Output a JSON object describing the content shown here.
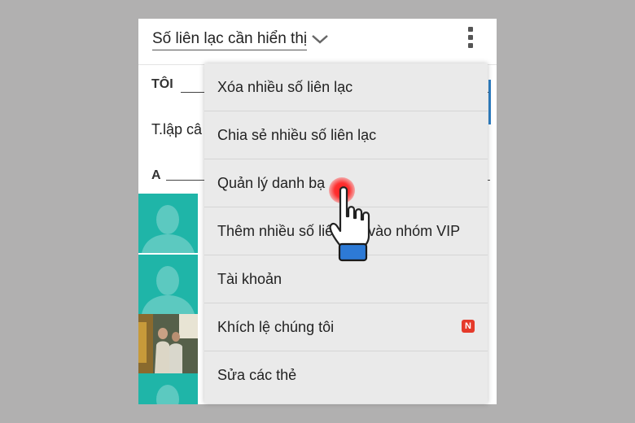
{
  "header": {
    "filter_label": "Số liên lạc cần hiển thị"
  },
  "contacts": {
    "section_me": "TÔI",
    "me_row_text": "T.lập câ",
    "section_a": "A"
  },
  "menu": {
    "items": [
      "Xóa nhiều số liên lạc",
      "Chia sẻ nhiều số liên lạc",
      "Quản lý danh bạ",
      "Thêm nhiều số liên lạc vào nhóm VIP",
      "Tài khoản",
      "Khích lệ chúng tôi",
      "Sửa các thẻ"
    ],
    "new_badge": "N"
  },
  "colors": {
    "avatar_bg": "#1fb5a8",
    "accent": "#2f7fc4",
    "badge": "#e53a2a"
  },
  "icons": [
    "chevron-down-icon",
    "overflow-menu-icon",
    "default-avatar-icon",
    "pointing-hand-icon"
  ]
}
